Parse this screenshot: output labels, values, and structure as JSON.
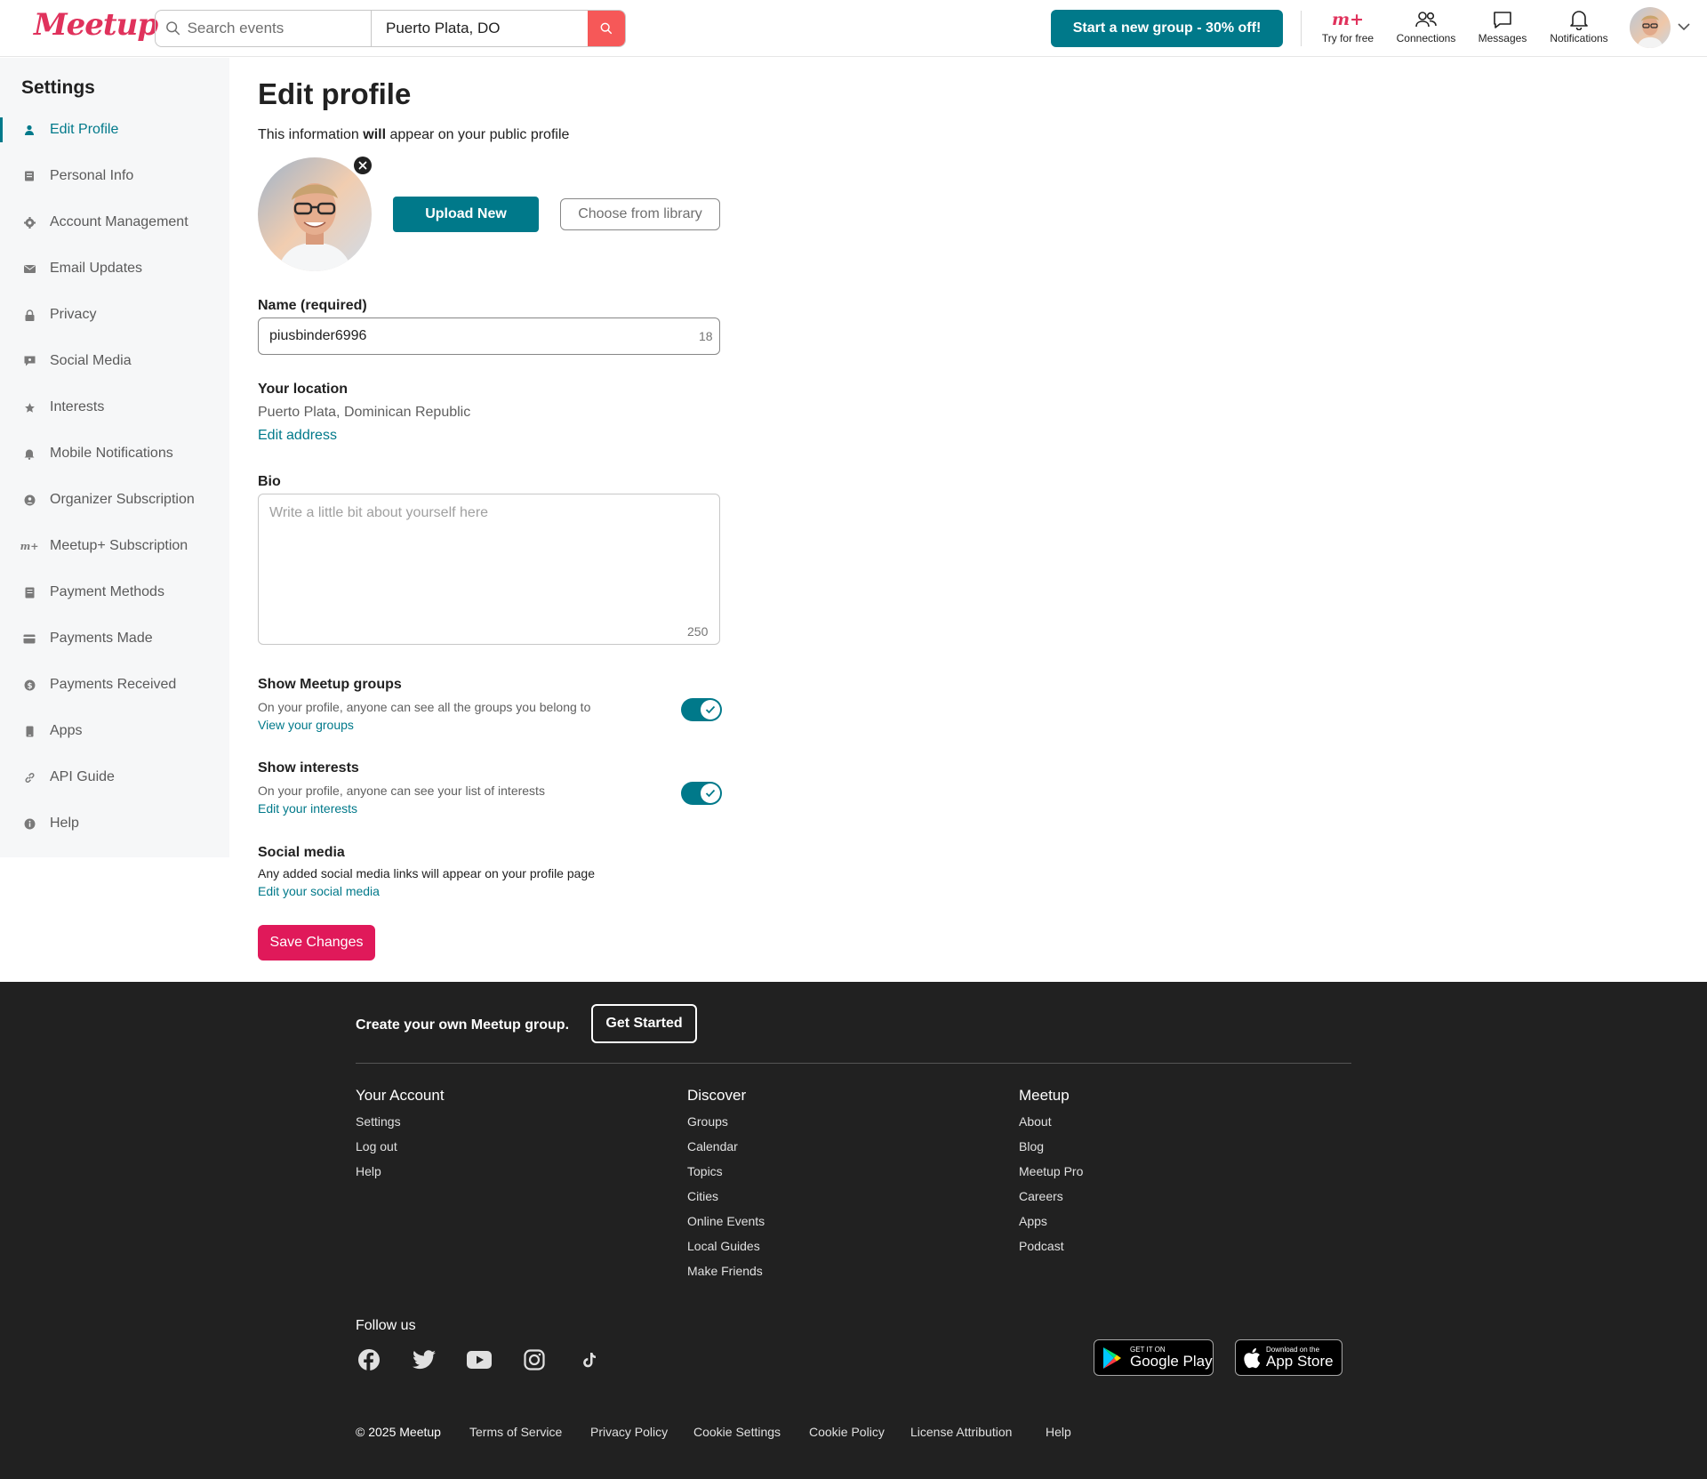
{
  "header": {
    "logo": "Meetup",
    "search_placeholder": "Search events",
    "location_value": "Puerto Plata, DO",
    "cta": "Start a new group - 30% off!",
    "nav": {
      "try_free": "Try for free",
      "connections": "Connections",
      "messages": "Messages",
      "notifications": "Notifications"
    }
  },
  "sidebar": {
    "title": "Settings",
    "items": [
      {
        "label": "Edit Profile",
        "icon": "person-icon"
      },
      {
        "label": "Personal Info",
        "icon": "id-card-icon"
      },
      {
        "label": "Account Management",
        "icon": "gear-icon"
      },
      {
        "label": "Email Updates",
        "icon": "envelope-icon"
      },
      {
        "label": "Privacy",
        "icon": "lock-icon"
      },
      {
        "label": "Social Media",
        "icon": "chat-icon"
      },
      {
        "label": "Interests",
        "icon": "star-icon"
      },
      {
        "label": "Mobile Notifications",
        "icon": "bell-icon"
      },
      {
        "label": "Organizer Subscription",
        "icon": "badge-icon"
      },
      {
        "label": "Meetup+ Subscription",
        "icon": "meetup-plus-icon"
      },
      {
        "label": "Payment Methods",
        "icon": "document-icon"
      },
      {
        "label": "Payments Made",
        "icon": "credit-card-icon"
      },
      {
        "label": "Payments Received",
        "icon": "coin-icon"
      },
      {
        "label": "Apps",
        "icon": "phone-icon"
      },
      {
        "label": "API Guide",
        "icon": "link-icon"
      },
      {
        "label": "Help",
        "icon": "info-icon"
      }
    ]
  },
  "main": {
    "title": "Edit profile",
    "subtitle_pre": "This information ",
    "subtitle_bold": "will",
    "subtitle_post": " appear on your public profile",
    "upload_btn": "Upload New",
    "library_btn": "Choose from library",
    "name_label": "Name (required)",
    "name_value": "piusbinder6996",
    "name_counter": "18",
    "location_label": "Your location",
    "location_value": "Puerto Plata, Dominican Republic",
    "edit_address": "Edit address",
    "bio_label": "Bio",
    "bio_placeholder": "Write a little bit about yourself here",
    "bio_counter": "250",
    "groups_label": "Show Meetup groups",
    "groups_desc": "On your profile, anyone can see all the groups you belong to",
    "groups_link": "View your groups",
    "groups_toggle_on": true,
    "interests_label": "Show interests",
    "interests_desc": "On your profile, anyone can see your list of interests",
    "interests_link": "Edit your interests",
    "interests_toggle_on": true,
    "social_label": "Social media",
    "social_desc": "Any added social media links will appear on your profile page",
    "social_link": "Edit your social media",
    "save_btn": "Save Changes"
  },
  "footer": {
    "create_text": "Create your own Meetup group.",
    "get_started": "Get Started",
    "columns": [
      {
        "title": "Your Account",
        "links": [
          "Settings",
          "Log out",
          "Help"
        ]
      },
      {
        "title": "Discover",
        "links": [
          "Groups",
          "Calendar",
          "Topics",
          "Cities",
          "Online Events",
          "Local Guides",
          "Make Friends"
        ]
      },
      {
        "title": "Meetup",
        "links": [
          "About",
          "Blog",
          "Meetup Pro",
          "Careers",
          "Apps",
          "Podcast"
        ]
      }
    ],
    "follow_us": "Follow us",
    "social_icons": [
      "facebook-icon",
      "twitter-icon",
      "youtube-icon",
      "instagram-icon",
      "tiktok-icon"
    ],
    "google_play_small": "GET IT ON",
    "google_play_big": "Google Play",
    "app_store_small": "Download on the",
    "app_store_big": "App Store",
    "bottom_links": [
      "© 2025 Meetup",
      "Terms of Service",
      "Privacy Policy",
      "Cookie Settings",
      "Cookie Policy",
      "License Attribution",
      "Help"
    ]
  },
  "colors": {
    "brand_red": "#e0325c",
    "teal": "#00798a",
    "save_pink": "#e0195a",
    "footer_bg": "#212121"
  }
}
